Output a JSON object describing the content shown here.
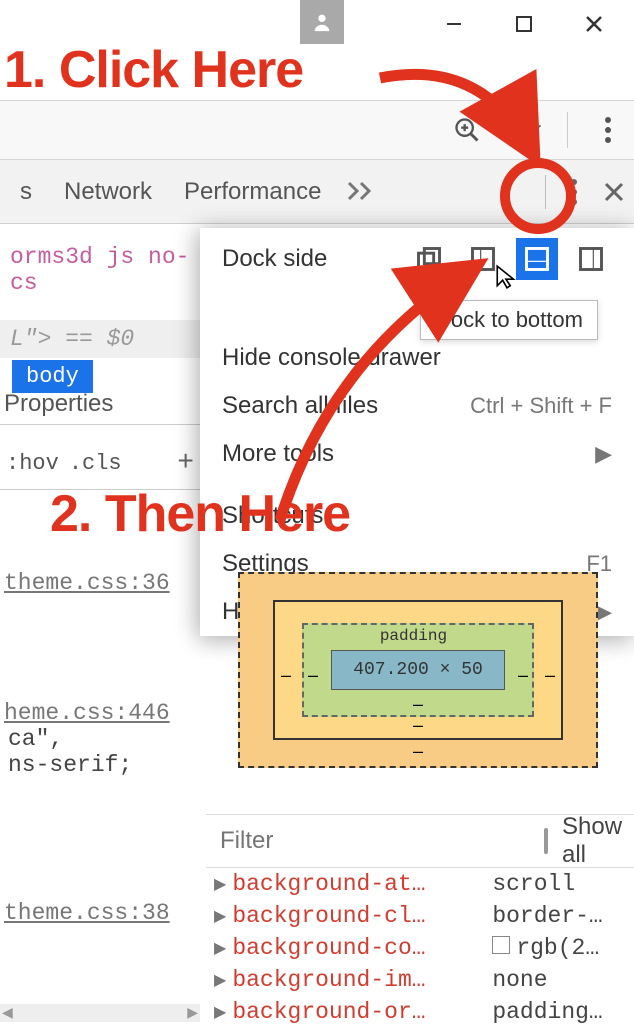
{
  "annotations": {
    "step1": "1. Click Here",
    "step2": "2. Then Here"
  },
  "window_controls": {
    "min": "—",
    "max": "☐",
    "close": "✕"
  },
  "devtools": {
    "tabs": {
      "partial_s": "s",
      "network": "Network",
      "performance": "Performance"
    },
    "elements_partial": "orms3d js no-cs",
    "eq_line": "L\"> == $0",
    "body_chip": "body",
    "properties_tab": "Properties",
    "hov": ":hov",
    "cls": ".cls"
  },
  "menu": {
    "dock_side": "Dock side",
    "tooltip": "Dock to bottom",
    "hide_drawer": "Hide console drawer",
    "search": "Search all files",
    "search_shortcut": "Ctrl + Shift + F",
    "more_tools": "More tools",
    "shortcuts": "Shortcuts",
    "settings": "Settings",
    "settings_shortcut": "F1",
    "help": "Help"
  },
  "sources": {
    "ref1": "theme.css:36",
    "ref2": "heme.css:446",
    "line2a": "ca\",",
    "line2b": "ns-serif;",
    "ref3": "theme.css:38"
  },
  "boxmodel": {
    "padding_label": "padding",
    "content": "407.200 × 50"
  },
  "filter": {
    "placeholder": "Filter",
    "show_all": "Show all"
  },
  "computed": [
    {
      "name": "background-at…",
      "value": "scroll"
    },
    {
      "name": "background-cl…",
      "value": "border-…"
    },
    {
      "name": "background-co…",
      "value": "rgb(2…",
      "swatch": true
    },
    {
      "name": "background-im…",
      "value": "none"
    },
    {
      "name": "background-or…",
      "value": "padding…"
    }
  ]
}
